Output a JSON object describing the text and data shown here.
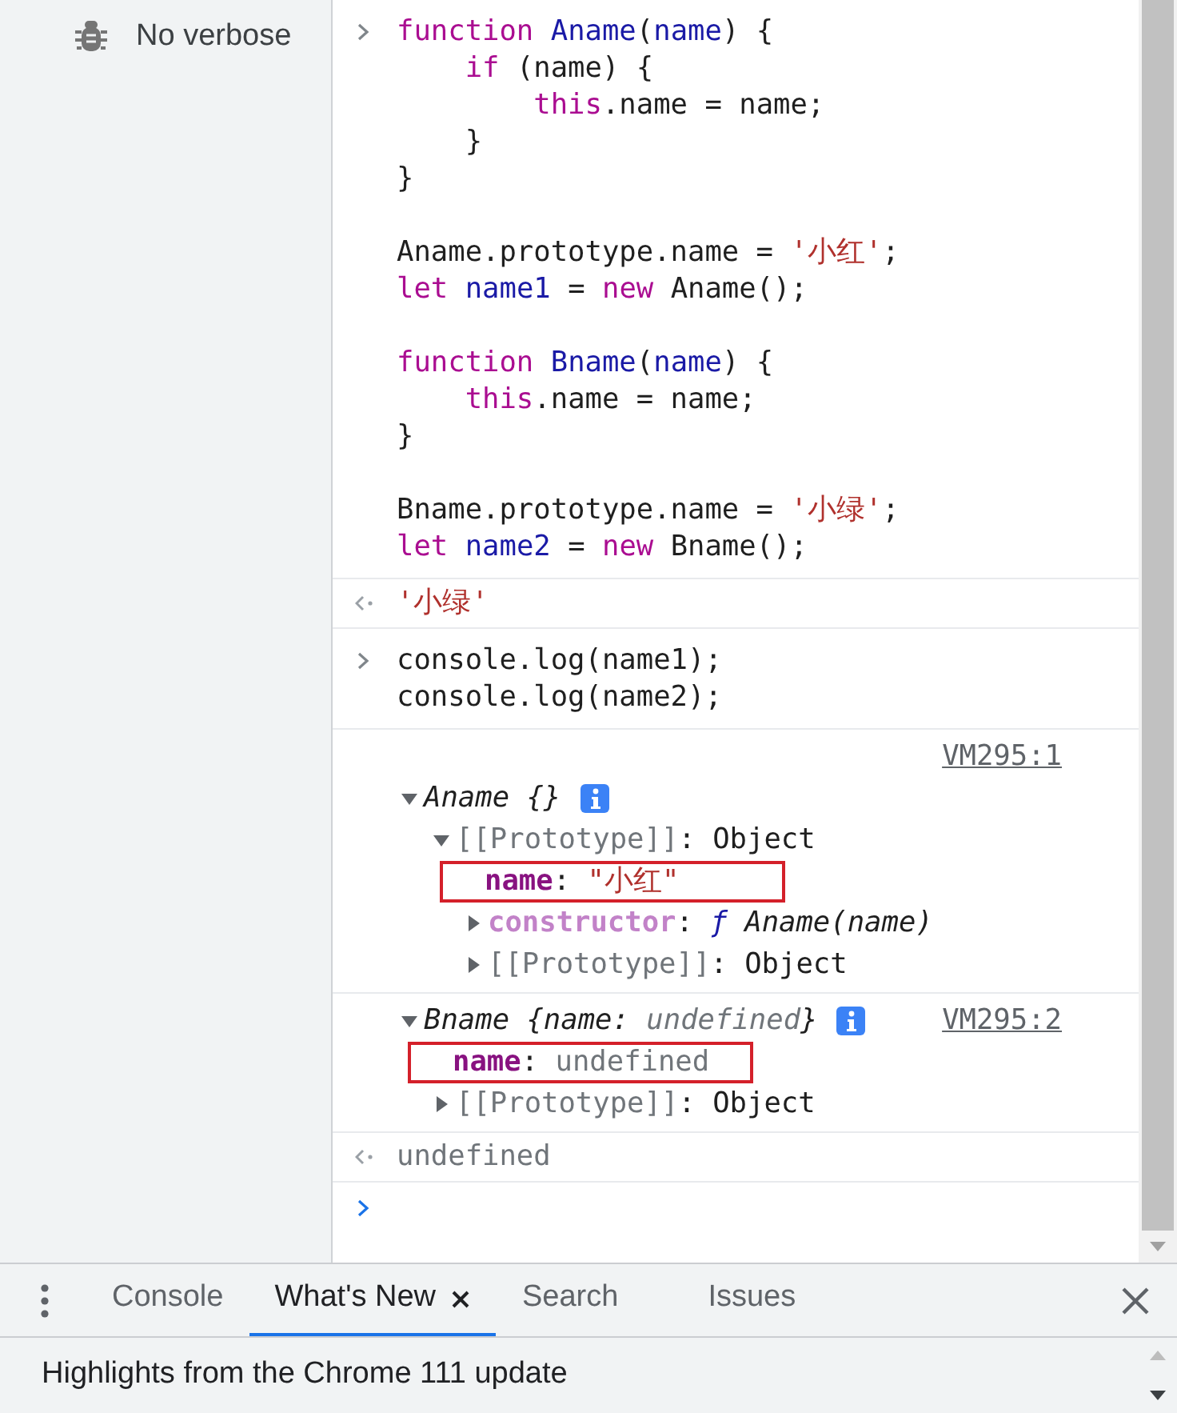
{
  "sidebar": {
    "items": [
      {
        "label": "No verbose"
      }
    ]
  },
  "console": {
    "entries": [
      {
        "kind": "input",
        "lines": [
          {
            "kind": "code",
            "tokens": [
              {
                "text": "function ",
                "kind": "keyword"
              },
              {
                "text": "Aname",
                "kind": "def"
              },
              {
                "text": "(",
                "kind": "plain"
              },
              {
                "text": "name",
                "kind": "def"
              },
              {
                "text": ") {",
                "kind": "plain"
              }
            ]
          },
          {
            "kind": "code",
            "tokens": [
              {
                "text": "    if",
                "kind": "keyword"
              },
              {
                "text": " (name) {",
                "kind": "plain"
              }
            ]
          },
          {
            "kind": "code",
            "tokens": [
              {
                "text": "        this",
                "kind": "keyword"
              },
              {
                "text": ".name = name;",
                "kind": "plain"
              }
            ]
          },
          {
            "kind": "code",
            "tokens": [
              {
                "text": "    }",
                "kind": "plain"
              }
            ]
          },
          {
            "kind": "code",
            "tokens": [
              {
                "text": "}",
                "kind": "plain"
              }
            ]
          },
          {
            "kind": "blank"
          },
          {
            "kind": "code",
            "tokens": [
              {
                "text": "Aname.prototype.name = ",
                "kind": "plain"
              },
              {
                "text": "'小红'",
                "kind": "string"
              },
              {
                "text": ";",
                "kind": "plain"
              }
            ]
          },
          {
            "kind": "code",
            "tokens": [
              {
                "text": "let ",
                "kind": "keyword"
              },
              {
                "text": "name1",
                "kind": "def"
              },
              {
                "text": " = ",
                "kind": "plain"
              },
              {
                "text": "new ",
                "kind": "keyword"
              },
              {
                "text": "Aname();",
                "kind": "plain"
              }
            ]
          },
          {
            "kind": "blank"
          },
          {
            "kind": "code",
            "tokens": [
              {
                "text": "function ",
                "kind": "keyword"
              },
              {
                "text": "Bname",
                "kind": "def"
              },
              {
                "text": "(",
                "kind": "plain"
              },
              {
                "text": "name",
                "kind": "def"
              },
              {
                "text": ") {",
                "kind": "plain"
              }
            ]
          },
          {
            "kind": "code",
            "tokens": [
              {
                "text": "    this",
                "kind": "keyword"
              },
              {
                "text": ".name = name;",
                "kind": "plain"
              }
            ]
          },
          {
            "kind": "code",
            "tokens": [
              {
                "text": "}",
                "kind": "plain"
              }
            ]
          },
          {
            "kind": "blank"
          },
          {
            "kind": "code",
            "tokens": [
              {
                "text": "Bname.prototype.name = ",
                "kind": "plain"
              },
              {
                "text": "'小绿'",
                "kind": "string"
              },
              {
                "text": ";",
                "kind": "plain"
              }
            ]
          },
          {
            "kind": "code",
            "tokens": [
              {
                "text": "let ",
                "kind": "keyword"
              },
              {
                "text": "name2",
                "kind": "def"
              },
              {
                "text": " = ",
                "kind": "plain"
              },
              {
                "text": "new ",
                "kind": "keyword"
              },
              {
                "text": "Bname();",
                "kind": "plain"
              }
            ]
          }
        ]
      },
      {
        "kind": "result",
        "value": {
          "text": "'小绿'",
          "kind": "string"
        }
      },
      {
        "kind": "input",
        "lines": [
          {
            "kind": "code",
            "tokens": [
              {
                "text": "console.log(name1);",
                "kind": "plain"
              }
            ]
          },
          {
            "kind": "code",
            "tokens": [
              {
                "text": "console.log(name2);",
                "kind": "plain"
              }
            ]
          }
        ]
      },
      {
        "kind": "log",
        "source": "VM295:1",
        "tree": {
          "kind": "expandable",
          "expanded": true,
          "info": true,
          "parts": [
            {
              "text": "Aname {}",
              "kind": "italic"
            }
          ],
          "children": [
            {
              "kind": "expandable",
              "expanded": true,
              "parts": [
                {
                  "text": "[[Prototype]]",
                  "kind": "dim"
                },
                {
                  "text": ": Object",
                  "kind": "plain"
                }
              ],
              "children": [
                {
                  "kind": "leaf",
                  "highlighted": true,
                  "parts": [
                    {
                      "text": "name",
                      "kind": "prop"
                    },
                    {
                      "text": ": ",
                      "kind": "plain"
                    },
                    {
                      "text": "\"小红\"",
                      "kind": "string"
                    }
                  ]
                },
                {
                  "kind": "expandable",
                  "expanded": false,
                  "parts": [
                    {
                      "text": "constructor",
                      "kind": "prop-dim"
                    },
                    {
                      "text": ": ",
                      "kind": "plain"
                    },
                    {
                      "text": "ƒ ",
                      "kind": "func"
                    },
                    {
                      "text": "Aname(name)",
                      "kind": "italic"
                    }
                  ]
                },
                {
                  "kind": "expandable",
                  "expanded": false,
                  "parts": [
                    {
                      "text": "[[Prototype]]",
                      "kind": "dim"
                    },
                    {
                      "text": ": Object",
                      "kind": "plain"
                    }
                  ]
                }
              ]
            }
          ]
        }
      },
      {
        "kind": "log",
        "tree": {
          "kind": "expandable",
          "source": "VM295:2",
          "expanded": true,
          "info": true,
          "parts": [
            {
              "text": "Bname {name: ",
              "kind": "italic"
            },
            {
              "text": "undefined",
              "kind": "dim-italic"
            },
            {
              "text": "}",
              "kind": "italic"
            }
          ],
          "children": [
            {
              "kind": "leaf",
              "highlighted": true,
              "parts": [
                {
                  "text": "name",
                  "kind": "prop"
                },
                {
                  "text": ": ",
                  "kind": "plain"
                },
                {
                  "text": "undefined",
                  "kind": "dim"
                }
              ]
            },
            {
              "kind": "expandable",
              "expanded": false,
              "parts": [
                {
                  "text": "[[Prototype]]",
                  "kind": "dim"
                },
                {
                  "text": ": Object",
                  "kind": "plain"
                }
              ]
            }
          ]
        }
      },
      {
        "kind": "result",
        "value": {
          "text": "undefined",
          "kind": "dim"
        }
      },
      {
        "kind": "prompt"
      }
    ]
  },
  "drawer": {
    "tabs": [
      {
        "label": "Console",
        "selected": false,
        "closable": false
      },
      {
        "label": "What's New",
        "selected": true,
        "closable": true
      },
      {
        "label": "Search",
        "selected": false,
        "closable": false
      },
      {
        "label": "Issues",
        "selected": false,
        "closable": false
      }
    ],
    "content": "Highlights from the Chrome 111 update"
  }
}
